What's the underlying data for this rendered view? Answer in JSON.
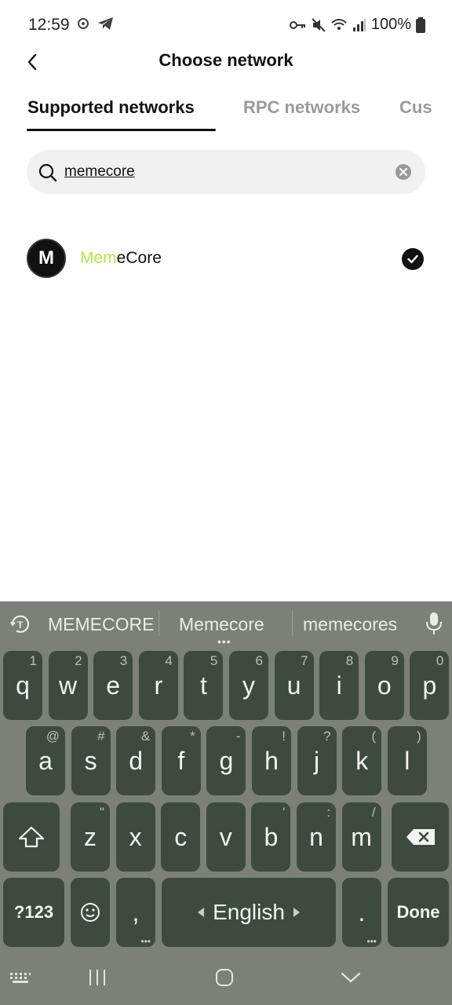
{
  "status_bar": {
    "time": "12:59",
    "battery": "100%"
  },
  "header": {
    "title": "Choose network"
  },
  "tabs": [
    {
      "label": "Supported networks",
      "active": true
    },
    {
      "label": "RPC networks",
      "active": false
    },
    {
      "label": "Cus",
      "active": false
    }
  ],
  "search": {
    "value": "memecore"
  },
  "networks": [
    {
      "logo_letter": "M",
      "name_highlight": "Mem",
      "name_rest": "eCore",
      "selected": true
    }
  ],
  "keyboard": {
    "suggestions": [
      "MEMECORE",
      "Memecore",
      "memecores"
    ],
    "rows": [
      [
        [
          "q",
          "1"
        ],
        [
          "w",
          "2"
        ],
        [
          "e",
          "3"
        ],
        [
          "r",
          "4"
        ],
        [
          "t",
          "5"
        ],
        [
          "y",
          "6"
        ],
        [
          "u",
          "7"
        ],
        [
          "i",
          "8"
        ],
        [
          "o",
          "9"
        ],
        [
          "p",
          "0"
        ]
      ],
      [
        [
          "a",
          "@"
        ],
        [
          "s",
          "#"
        ],
        [
          "d",
          "&"
        ],
        [
          "f",
          "*"
        ],
        [
          "g",
          "-"
        ],
        [
          "h",
          "!"
        ],
        [
          "j",
          "?"
        ],
        [
          "k",
          "("
        ],
        [
          "l",
          ")"
        ]
      ],
      [
        [
          "z",
          "\""
        ],
        [
          "x",
          ""
        ],
        [
          "c",
          ""
        ],
        [
          "v",
          ""
        ],
        [
          "b",
          "'"
        ],
        [
          "n",
          ":"
        ],
        [
          "m",
          "/"
        ]
      ]
    ],
    "symbols_label": "?123",
    "comma": ",",
    "space_label": "English",
    "period": ".",
    "done_label": "Done"
  },
  "colors": {
    "accent_highlight": "#b6e843",
    "keyboard_bg": "#7b8179",
    "key_bg": "#3f4a3f"
  }
}
